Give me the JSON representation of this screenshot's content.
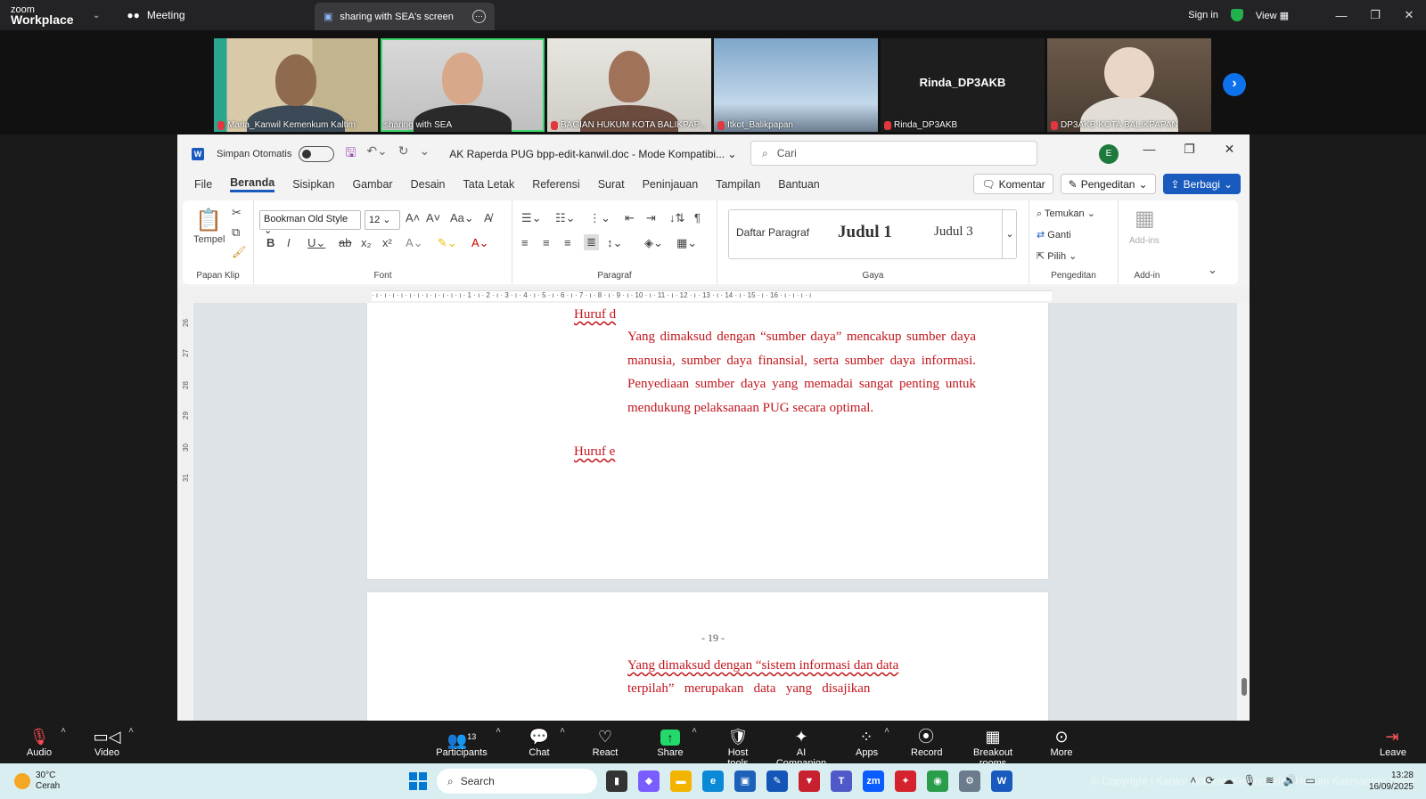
{
  "zoom": {
    "logo_brand": "zoom",
    "logo_product": "Workplace",
    "meeting_label": "Meeting",
    "share_tab": "sharing with SEA's screen",
    "sign_in": "Sign in",
    "view": "View"
  },
  "participants": [
    {
      "name": "Maria_Kanwil Kemenkum Kaltim",
      "muted": true,
      "active": false
    },
    {
      "name": "sharing with SEA",
      "muted": false,
      "active": true
    },
    {
      "name": "BAGIAN HUKUM KOTA BALIKPAP...",
      "muted": true,
      "active": false
    },
    {
      "name": "Itkot_Balikpapan",
      "muted": true,
      "active": false
    },
    {
      "name": "Rinda_DP3AKB",
      "display_name": "Rinda_DP3AKB",
      "muted": true,
      "active": false
    },
    {
      "name": "DP3AKB KOTA BALIKPAPAN",
      "muted": true,
      "active": false
    }
  ],
  "word": {
    "autosave_label": "Simpan Otomatis",
    "doc_title": "AK Raperda PUG bpp-edit-kanwil.doc  -  Mode Kompatibi...",
    "search_placeholder": "Cari",
    "avatar_initial": "E",
    "tabs": [
      "File",
      "Beranda",
      "Sisipkan",
      "Gambar",
      "Desain",
      "Tata Letak",
      "Referensi",
      "Surat",
      "Peninjauan",
      "Tampilan",
      "Bantuan"
    ],
    "selected_tab": "Beranda",
    "comment_btn": "Komentar",
    "editing_btn": "Pengeditan",
    "share_btn": "Berbagi",
    "ribbon": {
      "paste_label": "Tempel",
      "clipboard_group": "Papan Klip",
      "font_name": "Bookman Old Style",
      "font_size": "12",
      "font_group": "Font",
      "paragraph_group": "Paragraf",
      "styles": [
        "Daftar Paragraf",
        "Judul 1",
        "Judul 3"
      ],
      "styles_group": "Gaya",
      "find": "Temukan",
      "replace": "Ganti",
      "select": "Pilih",
      "editing_group": "Pengeditan",
      "addins": "Add-ins",
      "addins_group": "Add-in"
    },
    "ruler_text": "· ı · ı · ı · ı · ı · ı · ı · ı · ı · ı · ı · 1 · ı · 2 · ı · 3 · ı · 4 · ı · 5 · ı · 6 · ı · 7 · ı · 8 · ı · 9 · ı · 10 · ı · 11 · ı · 12 · ı · 13 · ı · 14 · ı · 15 · ı · 16 · ı · ı · ı · ı",
    "vruler": [
      "26",
      "27",
      "28",
      "29",
      "30",
      "31"
    ],
    "document": {
      "heading_d": "Huruf d",
      "para_d": "Yang dimaksud dengan “sumber daya” mencakup sumber daya manusia, sumber daya finansial, serta sumber daya informasi. Penyediaan sumber daya yang memadai sangat penting untuk mendukung pelaksanaan PUG secara optimal.",
      "heading_e": "Huruf e",
      "page_number": "- 19 -",
      "para_next_line1": "Yang dimaksud dengan “sistem informasi dan data",
      "para_next_line2": "terpilah”   merupakan   data   yang   disajikan"
    }
  },
  "zoom_toolbar": {
    "audio": "Audio",
    "video": "Video",
    "participants": "Participants",
    "participant_count": "13",
    "chat": "Chat",
    "react": "React",
    "share": "Share",
    "host_tools": "Host tools",
    "ai_companion": "AI Companion",
    "apps": "Apps",
    "record": "Record",
    "breakout": "Breakout rooms",
    "more": "More",
    "leave": "Leave"
  },
  "taskbar": {
    "temperature": "30°C",
    "weather": "Cerah",
    "search": "Search",
    "time": "13:28",
    "date": "16/09/2025",
    "watermark": "© Copyright | Kantor Wilayah Kementerian Hukum Kalimantan Timur"
  },
  "colors": {
    "zoom_active": "#3cd66b",
    "word_blue": "#185abd",
    "doc_text": "#c1161d"
  }
}
